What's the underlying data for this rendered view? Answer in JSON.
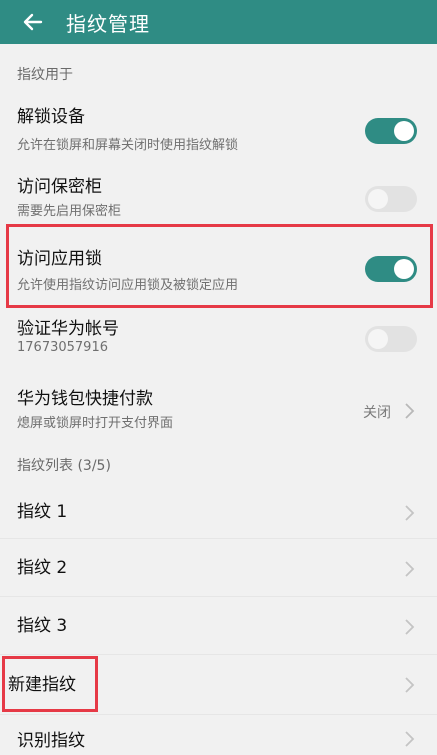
{
  "header": {
    "title": "指纹管理",
    "back_icon": "arrow-left-icon"
  },
  "sections": {
    "usage": "指纹用于",
    "list": "指纹列表 (3/5)"
  },
  "settings": [
    {
      "title": "解锁设备",
      "subtitle": "允许在锁屏和屏幕关闭时使用指纹解锁",
      "state": "on"
    },
    {
      "title": "访问保密柜",
      "subtitle": "需要先启用保密柜",
      "state": "off"
    },
    {
      "title": "访问应用锁",
      "subtitle": "允许使用指纹访问应用锁及被锁定应用",
      "state": "on"
    },
    {
      "title": "验证华为帐号",
      "subtitle": "17673057916",
      "state": "off"
    },
    {
      "title": "华为钱包快捷付款",
      "subtitle": "熄屏或锁屏时打开支付界面",
      "value": "关闭"
    }
  ],
  "fingerprints": [
    {
      "label": "指纹 1"
    },
    {
      "label": "指纹 2"
    },
    {
      "label": "指纹 3"
    }
  ],
  "actions": {
    "new_fingerprint": "新建指纹",
    "identify_fingerprint": "识别指纹"
  },
  "colors": {
    "accent": "#2f8c84",
    "highlight": "#e63946"
  }
}
